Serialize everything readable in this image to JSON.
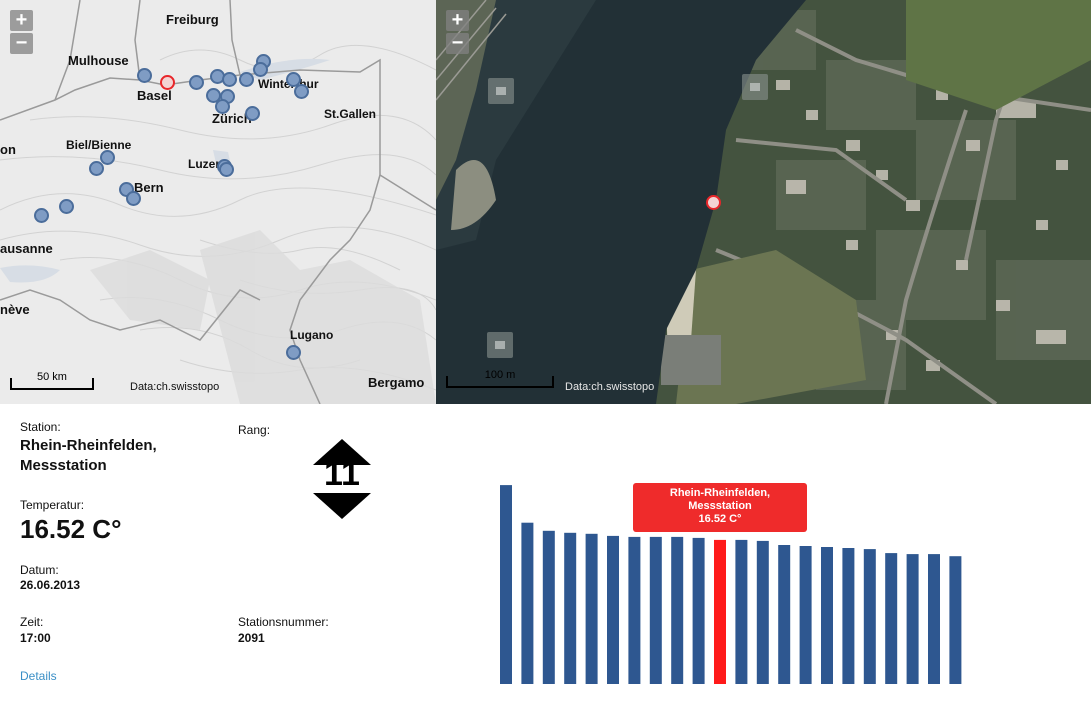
{
  "map_overview": {
    "zoom_in": "+",
    "zoom_out": "−",
    "cities": [
      {
        "name": "Freiburg"
      },
      {
        "name": "Mulhouse"
      },
      {
        "name": "Basel"
      },
      {
        "name": "Winterthur"
      },
      {
        "name": "Zürich"
      },
      {
        "name": "St.Gallen"
      },
      {
        "name": "Biel/Bienne"
      },
      {
        "name": "Luzern"
      },
      {
        "name": "Bern"
      },
      {
        "name": "ausanne"
      },
      {
        "name": "on"
      },
      {
        "name": "nève"
      },
      {
        "name": "Lugano"
      },
      {
        "name": "Bergamo"
      }
    ],
    "scale_label": "50 km",
    "attribution": "Data:ch.swisstopo"
  },
  "map_detail": {
    "zoom_in": "+",
    "zoom_out": "−",
    "scale_label": "100 m",
    "attribution": "Data:ch.swisstopo"
  },
  "info": {
    "station_label": "Station:",
    "station_name": "Rhein-Rheinfelden, Messstation",
    "rank_label": "Rang:",
    "rank_value": "11",
    "temp_label": "Temperatur:",
    "temp_value": "16.52 C°",
    "date_label": "Datum:",
    "date_value": "26.06.2013",
    "time_label": "Zeit:",
    "time_value": "17:00",
    "stationnr_label": "Stationsnummer:",
    "stationnr_value": "2091",
    "details_link": "Details"
  },
  "tooltip": {
    "line1": "Rhein-Rheinfelden,",
    "line2": "Messstation",
    "line3": "16.52 C°"
  },
  "colors": {
    "bar": "#2e5790",
    "highlight": "#ff1a1a",
    "tooltip_bg": "#ef2b2b",
    "link": "#3a8fc6"
  },
  "chart_data": {
    "type": "bar",
    "title": "",
    "xlabel": "",
    "ylabel": "",
    "highlight_index": 10,
    "ylim": [
      0,
      20.5
    ],
    "values": [
      19.6,
      15.9,
      15.1,
      14.9,
      14.8,
      14.6,
      14.5,
      14.5,
      14.5,
      14.4,
      14.2,
      14.2,
      14.1,
      13.7,
      13.6,
      13.5,
      13.4,
      13.3,
      12.9,
      12.8,
      12.8,
      12.6
    ]
  }
}
